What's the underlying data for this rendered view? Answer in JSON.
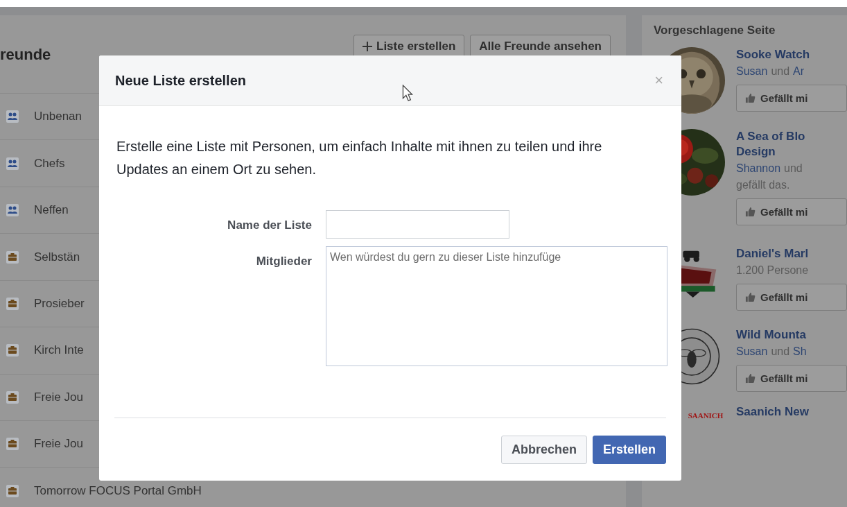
{
  "friends": {
    "title": "reunde",
    "buttons": [
      {
        "label": "Liste erstellen"
      },
      {
        "label": "Alle Freunde ansehen"
      }
    ],
    "lists": [
      {
        "kind": "people",
        "label": "Unbenan"
      },
      {
        "kind": "people",
        "label": "Chefs"
      },
      {
        "kind": "people",
        "label": "Neffen"
      },
      {
        "kind": "work",
        "label": "Selbstän"
      },
      {
        "kind": "work",
        "label": "Prosieber"
      },
      {
        "kind": "work",
        "label": "Kirch Inte"
      },
      {
        "kind": "work",
        "label": "Freie Jou"
      },
      {
        "kind": "work",
        "label": "Freie Jou"
      },
      {
        "kind": "work",
        "label": "Tomorrow FOCUS Portal GmbH"
      }
    ]
  },
  "suggestions": {
    "title": "Vorgeschlagene Seite",
    "pages": [
      {
        "kind": "owl",
        "title": [
          "Sooke Watch"
        ],
        "subtitle": [
          [
            {
              "text": "Susan",
              "link": true
            },
            {
              "text": "und",
              "link": false
            },
            {
              "text": "Ar",
              "link": true
            }
          ]
        ],
        "button": "Gefällt mi"
      },
      {
        "kind": "rose",
        "title": [
          "A Sea of Blo",
          "Design"
        ],
        "subtitle": [
          [
            {
              "text": "Shannon",
              "link": true
            },
            {
              "text": "und",
              "link": false
            }
          ],
          [
            {
              "text": "gefällt das.",
              "link": false
            }
          ]
        ],
        "button": "Gefällt mi"
      },
      {
        "kind": "market",
        "title": [
          "Daniel's Marl"
        ],
        "subtitle": [
          [
            {
              "text": "1.200 Persone",
              "link": false
            }
          ]
        ],
        "button": "Gefällt mi"
      },
      {
        "kind": "bee",
        "title": [
          "Wild Mounta"
        ],
        "subtitle": [
          [
            {
              "text": "Susan",
              "link": true
            },
            {
              "text": "und",
              "link": false
            },
            {
              "text": "Sh",
              "link": true
            }
          ]
        ],
        "button": "Gefällt mi"
      },
      {
        "kind": "wordmark",
        "logo_text": "SAANICH",
        "title": [
          "Saanich New"
        ]
      }
    ]
  },
  "dialog": {
    "title": "Neue Liste erstellen",
    "close": "×",
    "description": "Erstelle eine Liste mit Personen, um einfach Inhalte mit ihnen zu teilen und ihre Updates an einem Ort zu sehen.",
    "fields": [
      {
        "kind": "input",
        "label": "Name der Liste"
      },
      {
        "kind": "textarea",
        "label": "Mitglieder",
        "placeholder": "Wen würdest du gern zu dieser Liste hinzufüge"
      }
    ],
    "buttons": [
      {
        "label": "Abbrechen",
        "primary": false
      },
      {
        "label": "Erstellen",
        "primary": true
      }
    ]
  }
}
